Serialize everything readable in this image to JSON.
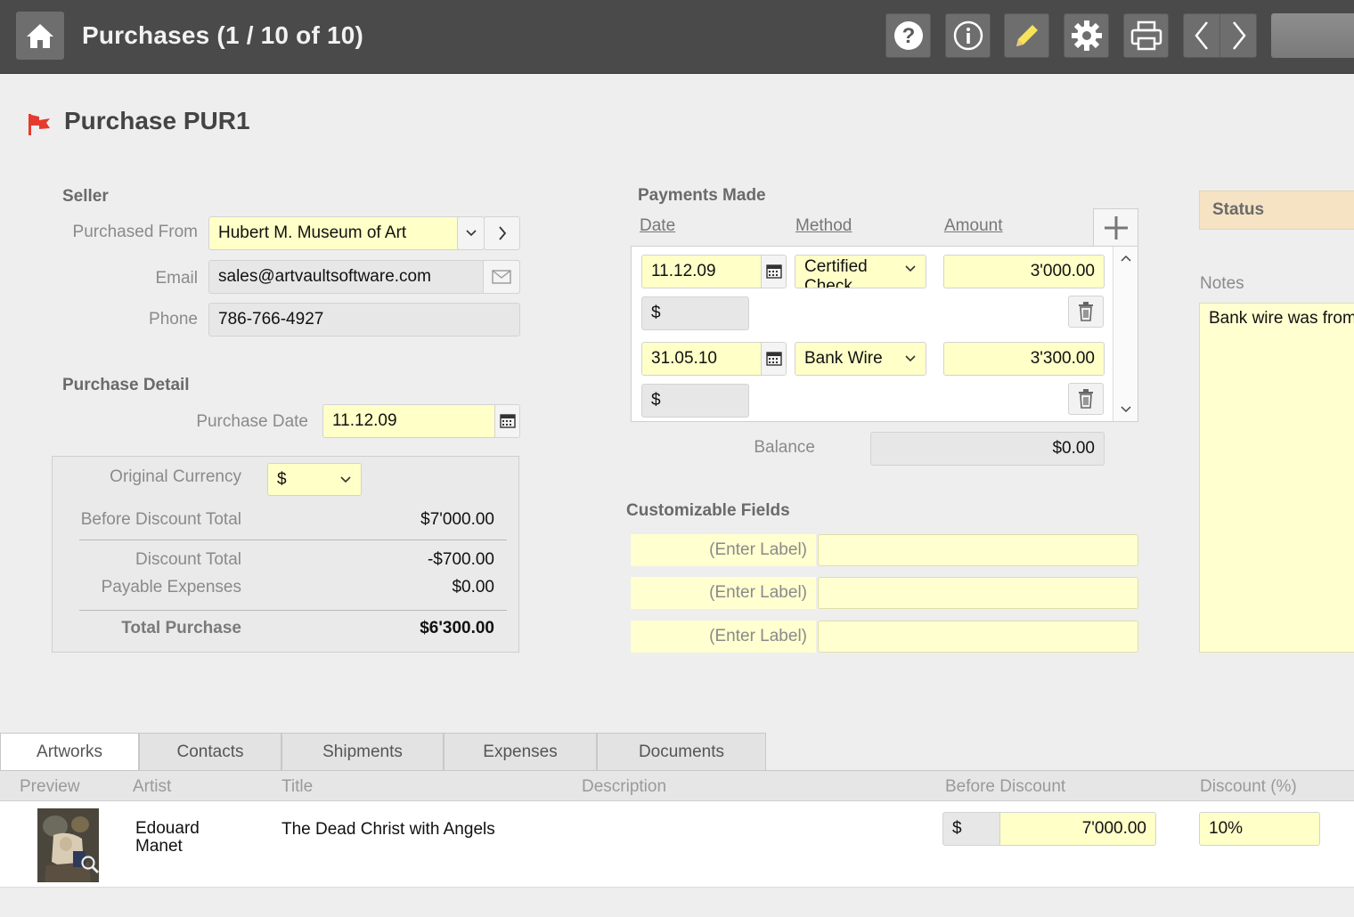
{
  "window": {
    "title": "Purchases (1 / 10 of 10)"
  },
  "toolbar": {
    "home": "home-icon",
    "help": "help-icon",
    "info": "info-icon",
    "edit": "pencil-icon",
    "settings": "gear-icon",
    "print": "print-icon",
    "prev": "chevron-left-icon",
    "next": "chevron-right-icon"
  },
  "record": {
    "title": "Purchase PUR1",
    "flag_color": "#e53b2c"
  },
  "seller": {
    "heading": "Seller",
    "purchased_from_label": "Purchased From",
    "purchased_from_value": "Hubert M. Museum of Art",
    "email_label": "Email",
    "email_value": "sales@artvaultsoftware.com",
    "phone_label": "Phone",
    "phone_value": "786-766-4927"
  },
  "purchase_detail": {
    "heading": "Purchase Detail",
    "date_label": "Purchase Date",
    "date_value": "11.12.09",
    "currency_label": "Original Currency",
    "currency_value": "$",
    "before_discount_label": "Before Discount Total",
    "before_discount_value": "$7'000.00",
    "discount_label": "Discount Total",
    "discount_value": "-$700.00",
    "expenses_label": "Payable Expenses",
    "expenses_value": "$0.00",
    "total_label": "Total Purchase",
    "total_value": "$6'300.00"
  },
  "payments": {
    "heading": "Payments Made",
    "col_date": "Date",
    "col_method": "Method",
    "col_amount": "Amount",
    "rows": [
      {
        "date": "11.12.09",
        "method": "Certified Check",
        "amount": "3'000.00",
        "currency": "$"
      },
      {
        "date": "31.05.10",
        "method": "Bank Wire",
        "amount": "3'300.00",
        "currency": "$"
      }
    ],
    "balance_label": "Balance",
    "balance_value": "$0.00"
  },
  "custom_fields": {
    "heading": "Customizable Fields",
    "labels": [
      "(Enter Label)",
      "(Enter Label)",
      "(Enter Label)"
    ]
  },
  "status": {
    "heading": "Status"
  },
  "notes": {
    "label": "Notes",
    "value": "Bank wire was from"
  },
  "tabs": [
    "Artworks",
    "Contacts",
    "Shipments",
    "Expenses",
    "Documents"
  ],
  "artworks_table": {
    "headers": [
      "Preview",
      "Artist",
      "Title",
      "Description",
      "Before Discount",
      "Discount (%)"
    ],
    "rows": [
      {
        "artist_first": "Edouard",
        "artist_last": "Manet",
        "title": "The Dead Christ with Angels",
        "description": "",
        "currency": "$",
        "before_discount": "7'000.00",
        "discount": "10%"
      }
    ]
  },
  "colors": {
    "topbar": "#4a4a4a",
    "field_yellow": "#ffffc8",
    "status_bg": "#f5e3c4",
    "flag": "#e53b2c"
  }
}
